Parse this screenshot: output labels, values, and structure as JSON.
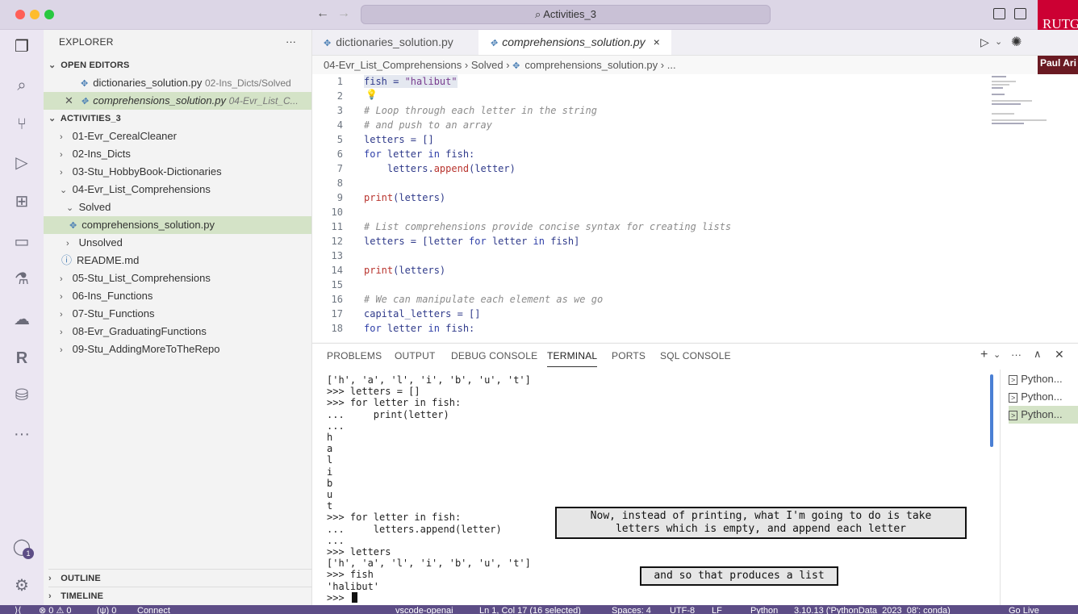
{
  "window": {
    "title": "Activities_3"
  },
  "overlay": {
    "logo_text": "RUTG",
    "presenter": "Paul Ari"
  },
  "activity_badge": "1",
  "sidebar": {
    "title": "EXPLORER",
    "more": "···",
    "open_editors_label": "OPEN EDITORS",
    "open_editors": [
      {
        "name": "dictionaries_solution.py",
        "path": "02-Ins_Dicts/Solved"
      },
      {
        "name": "comprehensions_solution.py",
        "path": "04-Evr_List_C..."
      }
    ],
    "folder_label": "ACTIVITIES_3",
    "tree": [
      "01-Evr_CerealCleaner",
      "02-Ins_Dicts",
      "03-Stu_HobbyBook-Dictionaries",
      "04-Evr_List_Comprehensions",
      "Solved",
      "comprehensions_solution.py",
      "Unsolved",
      "README.md",
      "05-Stu_List_Comprehensions",
      "06-Ins_Functions",
      "07-Stu_Functions",
      "08-Evr_GraduatingFunctions",
      "09-Stu_AddingMoreToTheRepo"
    ],
    "outline_label": "OUTLINE",
    "timeline_label": "TIMELINE"
  },
  "tabs": [
    {
      "label": "dictionaries_solution.py"
    },
    {
      "label": "comprehensions_solution.py",
      "close": "×"
    }
  ],
  "breadcrumb": [
    "04-Evr_List_Comprehensions",
    "Solved",
    "comprehensions_solution.py",
    "..."
  ],
  "code_lines": [
    "fish = \"halibut\"",
    "",
    "# Loop through each letter in the string",
    "# and push to an array",
    "letters = []",
    "for letter in fish:",
    "    letters.append(letter)",
    "",
    "print(letters)",
    "",
    "# List comprehensions provide concise syntax for creating lists",
    "letters = [letter for letter in fish]",
    "",
    "print(letters)",
    "",
    "# We can manipulate each element as we go",
    "capital_letters = []",
    "for letter in fish:"
  ],
  "panel": {
    "tabs": [
      "PROBLEMS",
      "OUTPUT",
      "DEBUG CONSOLE",
      "TERMINAL",
      "PORTS",
      "SQL CONSOLE"
    ],
    "active_tab": "TERMINAL",
    "terminal_lines": [
      "['h', 'a', 'l', 'i', 'b', 'u', 't']",
      ">>> letters = []",
      ">>> for letter in fish:",
      "...     print(letter)",
      "...",
      "h",
      "a",
      "l",
      "i",
      "b",
      "u",
      "t",
      ">>> for letter in fish:",
      "...     letters.append(letter)",
      "...",
      ">>> letters",
      "['h', 'a', 'l', 'i', 'b', 'u', 't']",
      ">>> fish",
      "'halibut'",
      ">>> "
    ],
    "terminals": [
      "Python...",
      "Python...",
      "Python..."
    ]
  },
  "captions": {
    "caption1_line1": "Now, instead of printing, what I'm going to do is take",
    "caption1_line2": "letters which is empty, and append each letter",
    "caption2": "and so that produces a list"
  },
  "statusbar": {
    "problems": "⊗ 0 ⚠ 0",
    "ports": "(ψ) 0",
    "connect": "Connect",
    "remote": "vscode-openai",
    "position": "Ln 1, Col 17 (16 selected)",
    "spaces": "Spaces: 4",
    "encoding": "UTF-8",
    "eol": "LF",
    "language": "Python",
    "interpreter": "3.10.13 ('PythonData_2023_08': conda)",
    "golive": "Go Live"
  }
}
